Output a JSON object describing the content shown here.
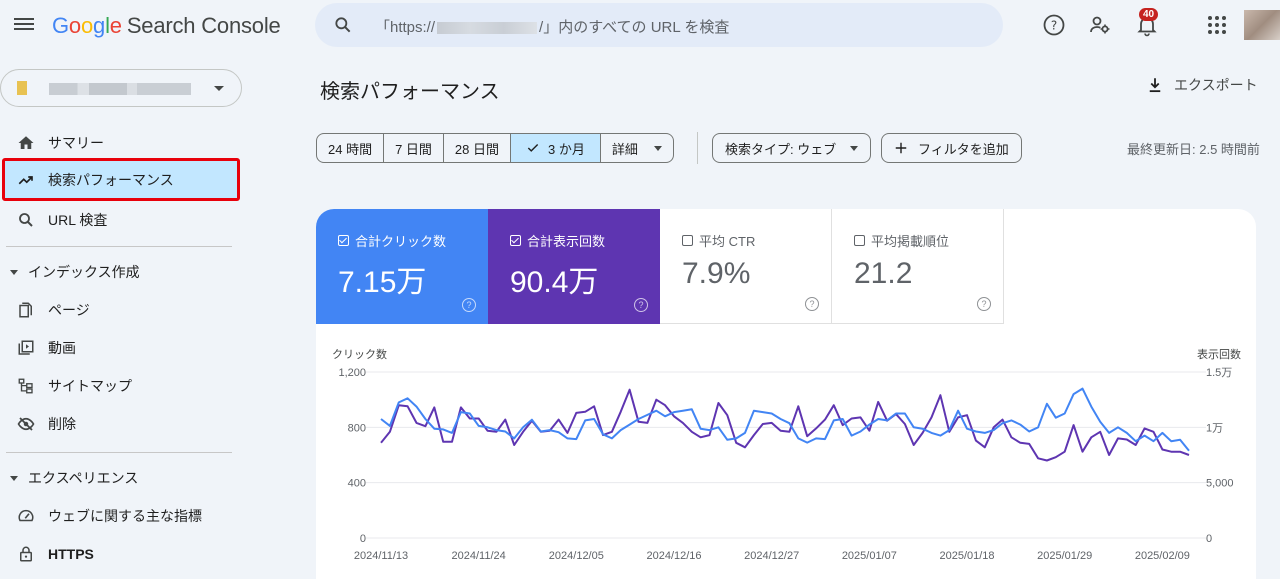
{
  "app": {
    "logo_letters": [
      "G",
      "o",
      "o",
      "g",
      "l",
      "e"
    ],
    "product": "Search Console"
  },
  "search": {
    "prefix": "「https://",
    "suffix": "/」内のすべての URL を検査"
  },
  "header": {
    "notifications_count": "40",
    "icons": [
      "help-icon",
      "manage-users-icon",
      "notifications-icon",
      "apps-icon",
      "account-avatar"
    ]
  },
  "sidebar": {
    "items": [
      {
        "label": "サマリー",
        "icon": "home-icon"
      },
      {
        "label": "検索パフォーマンス",
        "icon": "trending-up-icon",
        "active": true
      },
      {
        "label": "URL 検査",
        "icon": "search-icon"
      }
    ],
    "sections": [
      {
        "label": "インデックス作成",
        "items": [
          {
            "label": "ページ",
            "icon": "pages-icon"
          },
          {
            "label": "動画",
            "icon": "video-icon"
          },
          {
            "label": "サイトマップ",
            "icon": "sitemap-icon"
          },
          {
            "label": "削除",
            "icon": "visibility-off-icon"
          }
        ]
      },
      {
        "label": "エクスペリエンス",
        "items": [
          {
            "label": "ウェブに関する主な指標",
            "icon": "speed-icon"
          },
          {
            "label": "HTTPS",
            "icon": "lock-icon"
          }
        ]
      }
    ]
  },
  "main": {
    "title": "検索パフォーマンス",
    "export_label": "エクスポート",
    "date_ranges": [
      {
        "label": "24 時間"
      },
      {
        "label": "7 日間"
      },
      {
        "label": "28 日間"
      },
      {
        "label": "3 か月",
        "selected": true
      },
      {
        "label": "詳細"
      }
    ],
    "search_type": "検索タイプ: ウェブ",
    "add_filter": "フィルタを追加",
    "last_updated": "最終更新日: 2.5 時間前",
    "metrics": [
      {
        "label": "合計クリック数",
        "value": "7.15万",
        "checked": true,
        "color": "#4285f4"
      },
      {
        "label": "合計表示回数",
        "value": "90.4万",
        "checked": true,
        "color": "#5e35b1"
      },
      {
        "label": "平均 CTR",
        "value": "7.9%",
        "checked": false
      },
      {
        "label": "平均掲載順位",
        "value": "21.2",
        "checked": false
      }
    ]
  },
  "chart_data": {
    "type": "line",
    "left_axis_label": "クリック数",
    "right_axis_label": "表示回数",
    "left_ticks": [
      "0",
      "400",
      "800",
      "1,200"
    ],
    "left_ylim": [
      0,
      1200
    ],
    "right_ticks": [
      "0",
      "5,000",
      "1万",
      "1.5万"
    ],
    "right_ylim": [
      0,
      15000
    ],
    "x_start": "2024/11/13",
    "x_end": "2025/02/12",
    "x_tick_labels": [
      "2024/11/13",
      "2024/11/24",
      "2024/12/05",
      "2024/12/16",
      "2024/12/27",
      "2025/01/07",
      "2025/01/18",
      "2025/01/29",
      "2025/02/09"
    ],
    "x_tick_day_offsets": [
      0,
      11,
      22,
      33,
      44,
      55,
      66,
      77,
      88
    ],
    "grid": true,
    "series": [
      {
        "name": "クリック数",
        "axis": "left",
        "color": "#4285f4",
        "values": [
          860,
          810,
          980,
          1010,
          950,
          860,
          790,
          785,
          760,
          910,
          900,
          810,
          800,
          780,
          770,
          720,
          800,
          855,
          770,
          780,
          765,
          720,
          715,
          850,
          860,
          750,
          720,
          780,
          820,
          860,
          890,
          920,
          880,
          910,
          920,
          930,
          790,
          780,
          800,
          710,
          720,
          760,
          920,
          910,
          900,
          860,
          830,
          720,
          690,
          720,
          715,
          850,
          860,
          740,
          770,
          820,
          860,
          850,
          900,
          900,
          800,
          790,
          760,
          740,
          780,
          920,
          790,
          770,
          760,
          780,
          830,
          850,
          820,
          770,
          800,
          970,
          870,
          900,
          1040,
          1080,
          950,
          840,
          760,
          800,
          760,
          700,
          740,
          700,
          760,
          700,
          710,
          630
        ]
      },
      {
        "name": "表示回数",
        "axis": "right",
        "color": "#5e35b1",
        "values": [
          8600,
          9600,
          12000,
          11900,
          10400,
          10100,
          11800,
          8700,
          8700,
          11800,
          10800,
          10800,
          9700,
          9600,
          10700,
          8400,
          9600,
          10600,
          9600,
          9700,
          10700,
          9500,
          11300,
          11400,
          11900,
          9300,
          9600,
          11400,
          13400,
          10500,
          10400,
          12500,
          12000,
          11000,
          10400,
          9600,
          9100,
          9300,
          12200,
          11100,
          8600,
          8200,
          9300,
          10300,
          10400,
          9700,
          9600,
          11900,
          9200,
          9900,
          10700,
          12000,
          10200,
          10800,
          10900,
          9700,
          12300,
          10600,
          11200,
          10300,
          8400,
          9500,
          10900,
          12900,
          9600,
          10900,
          11100,
          8800,
          8200,
          10000,
          10700,
          9100,
          8600,
          8500,
          7200,
          7000,
          7300,
          7800,
          10200,
          7800,
          9100,
          9600,
          7500,
          9000,
          8900,
          8400,
          9900,
          9600,
          8000,
          7800,
          7800,
          7500
        ]
      }
    ]
  }
}
